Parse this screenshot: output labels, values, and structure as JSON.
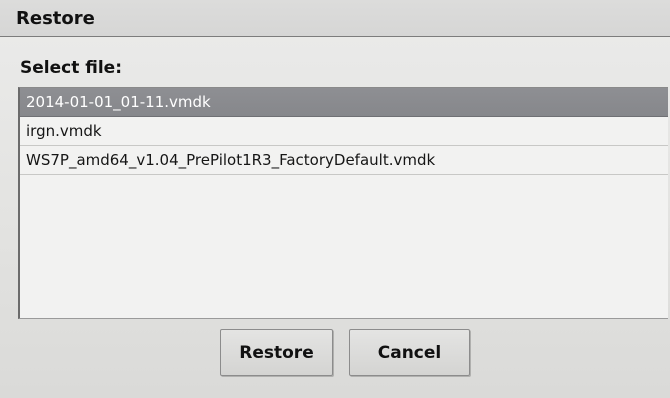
{
  "window": {
    "title": "Restore"
  },
  "content": {
    "select_label": "Select file:",
    "files": [
      {
        "name": "2014-01-01_01-11.vmdk",
        "selected": true
      },
      {
        "name": "irgn.vmdk",
        "selected": false
      },
      {
        "name": "WS7P_amd64_v1.04_PrePilot1R3_FactoryDefault.vmdk",
        "selected": false
      }
    ]
  },
  "buttons": {
    "restore_label": "Restore",
    "cancel_label": "Cancel"
  },
  "colors": {
    "selection_background": "#8a8b8f",
    "selection_text": "#ffffff",
    "dialog_background": "#e6e6e4"
  }
}
